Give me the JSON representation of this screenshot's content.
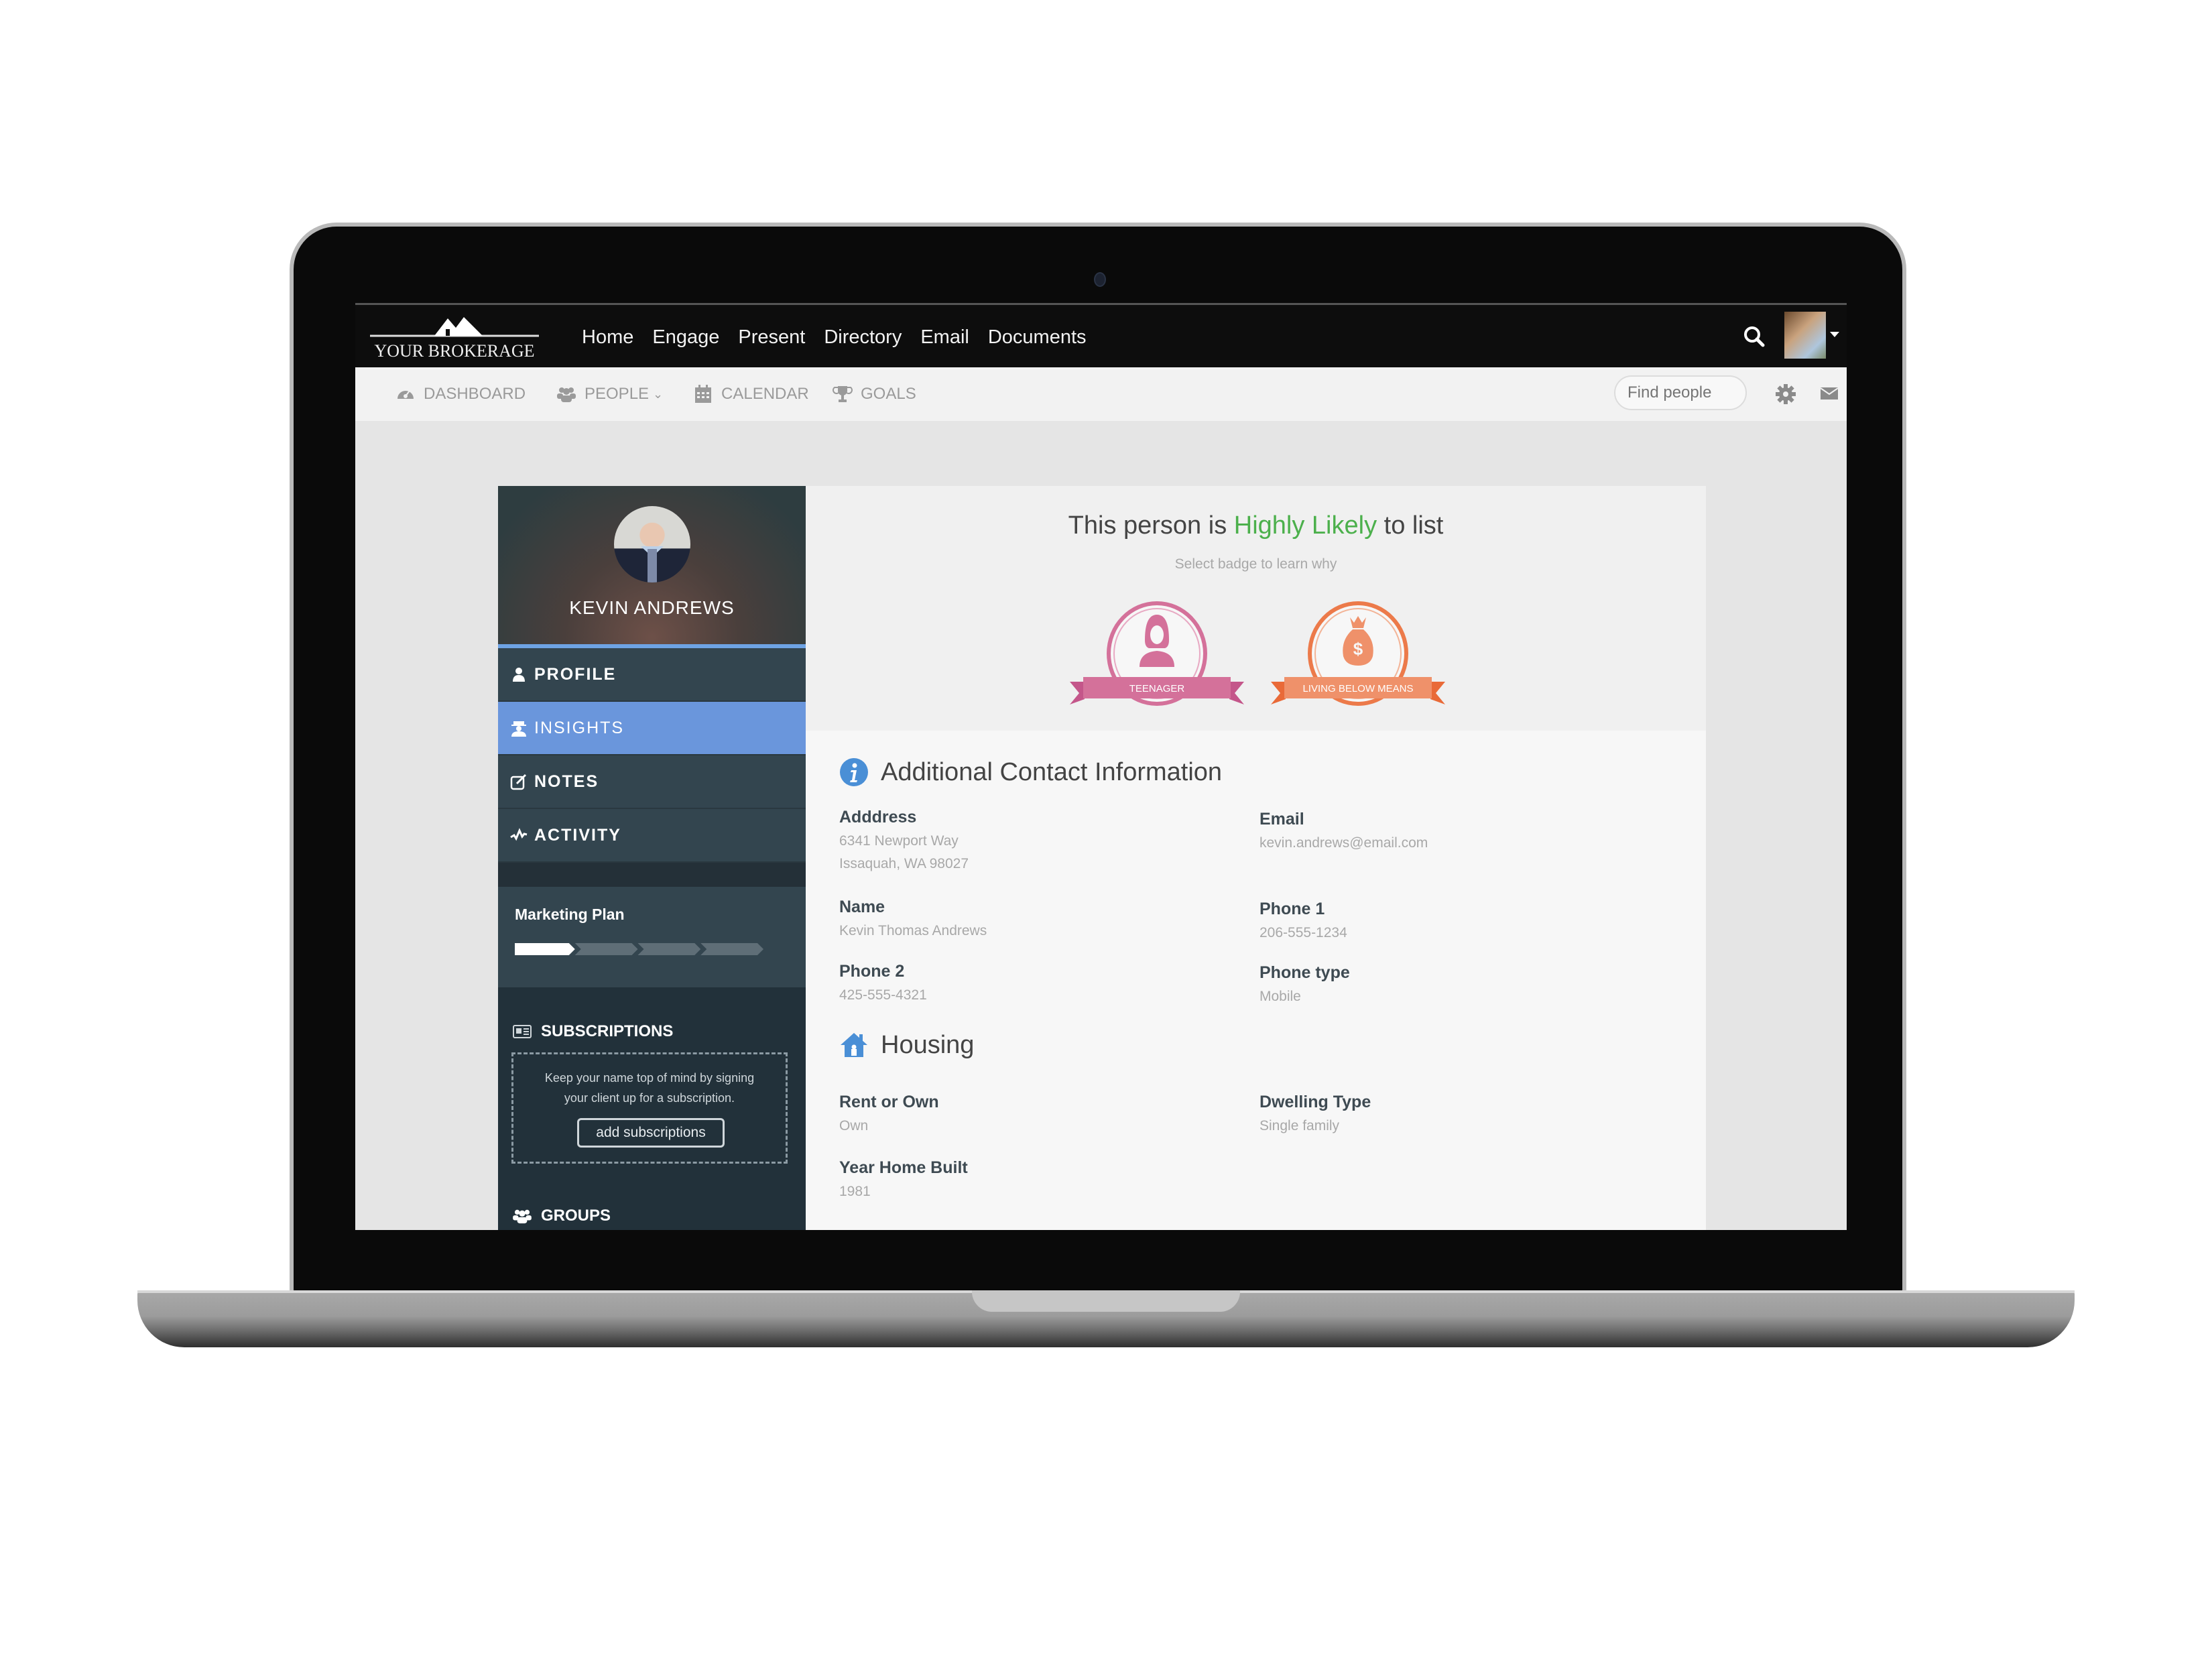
{
  "top_nav": {
    "logo_text": "YOUR BROKERAGE",
    "links": [
      "Home",
      "Engage",
      "Present",
      "Directory",
      "Email",
      "Documents"
    ],
    "search_icon": "search-icon",
    "user_menu_icon": "caret-down-icon"
  },
  "sub_nav": {
    "items": [
      {
        "label": "DASHBOARD",
        "icon": "dashboard-icon"
      },
      {
        "label": "PEOPLE",
        "icon": "people-icon",
        "has_dropdown": true,
        "caret": "⌄"
      },
      {
        "label": "CALENDAR",
        "icon": "calendar-icon"
      },
      {
        "label": "GOALS",
        "icon": "trophy-icon"
      }
    ],
    "find_placeholder": "Find people",
    "settings_icon": "gear-icon",
    "mail_icon": "envelope-icon"
  },
  "contact": {
    "name": "KEVIN ANDREWS",
    "menu": [
      {
        "label": "PROFILE",
        "icon": "user-icon",
        "active": false
      },
      {
        "label": "INSIGHTS",
        "icon": "spy-icon",
        "active": true
      },
      {
        "label": "NOTES",
        "icon": "edit-icon",
        "active": false
      },
      {
        "label": "ACTIVITY",
        "icon": "activity-icon",
        "active": false
      }
    ],
    "marketing_plan": {
      "title": "Marketing Plan",
      "steps_total": 4,
      "steps_completed": 1
    },
    "subscriptions": {
      "title": "SUBSCRIPTIONS",
      "message": "Keep your name top of mind by signing your client up for a subscription.",
      "button": "add subscriptions"
    },
    "groups": {
      "title": "GROUPS"
    }
  },
  "insights": {
    "headline_prefix": "This person is",
    "headline_highlight": "Highly Likely",
    "headline_suffix": "to list",
    "subtitle": "Select badge to learn why",
    "badges": [
      {
        "label": "TEENAGER",
        "icon": "female-user-icon",
        "color": "#d4719a"
      },
      {
        "label": "LIVING BELOW MEANS",
        "icon": "money-bag-icon",
        "color": "#ec7a4a"
      }
    ],
    "highlight_color": "#4cb04c"
  },
  "additional_contact": {
    "title": "Additional Contact Information",
    "fields": [
      {
        "label": "Adddress",
        "value": [
          "6341 Newport Way",
          "Issaquah, WA 98027"
        ]
      },
      {
        "label": "Email",
        "value": [
          "kevin.andrews@email.com"
        ]
      },
      {
        "label": "Name",
        "value": [
          "Kevin Thomas Andrews"
        ]
      },
      {
        "label": "Phone 1",
        "value": [
          "206-555-1234"
        ]
      },
      {
        "label": "Phone 2",
        "value": [
          "425-555-4321"
        ]
      },
      {
        "label": "Phone type",
        "value": [
          "Mobile"
        ]
      }
    ]
  },
  "housing": {
    "title": "Housing",
    "fields": [
      {
        "label": "Rent or Own",
        "value": [
          "Own"
        ]
      },
      {
        "label": "Dwelling Type",
        "value": [
          "Single family"
        ]
      },
      {
        "label": "Year Home Built",
        "value": [
          "1981"
        ]
      }
    ]
  },
  "colors": {
    "accent_blue": "#6a96dc",
    "panel_dark": "#22313a",
    "info_blue": "#4a8fd6"
  }
}
